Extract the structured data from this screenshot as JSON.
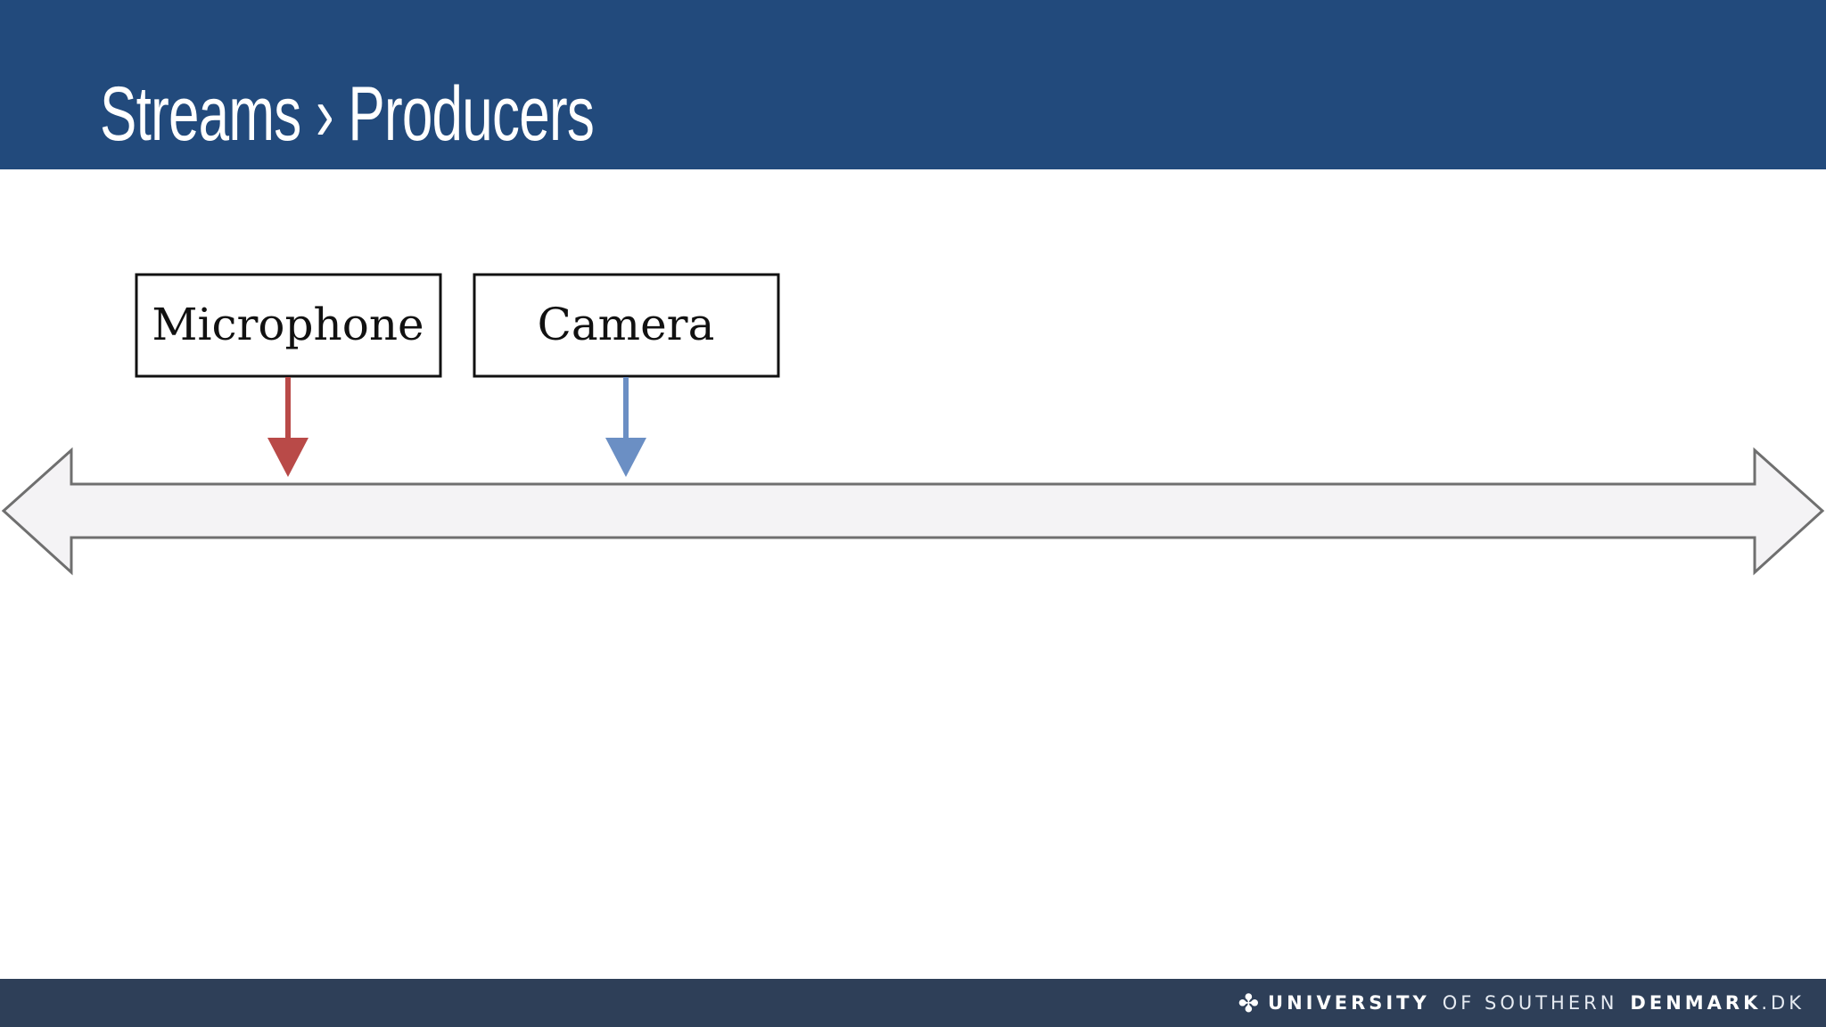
{
  "slide": {
    "title": "Streams › Producers"
  },
  "diagram": {
    "producers": [
      {
        "label": "Microphone",
        "arrow_color": "#b94a48"
      },
      {
        "label": "Camera",
        "arrow_color": "#6b8fc4"
      }
    ],
    "stream_fill": "#f4f3f5",
    "stream_stroke": "#6f6f6f"
  },
  "footer": {
    "logo_part1": "UNIVERSITY",
    "logo_part2": "OF SOUTHERN",
    "logo_part3": "DENMARK",
    "logo_part4": ".DK",
    "logo_icon": "sdu-bird-logo-icon"
  },
  "colors": {
    "header": "#224a7c",
    "footer": "#2e3f58"
  }
}
